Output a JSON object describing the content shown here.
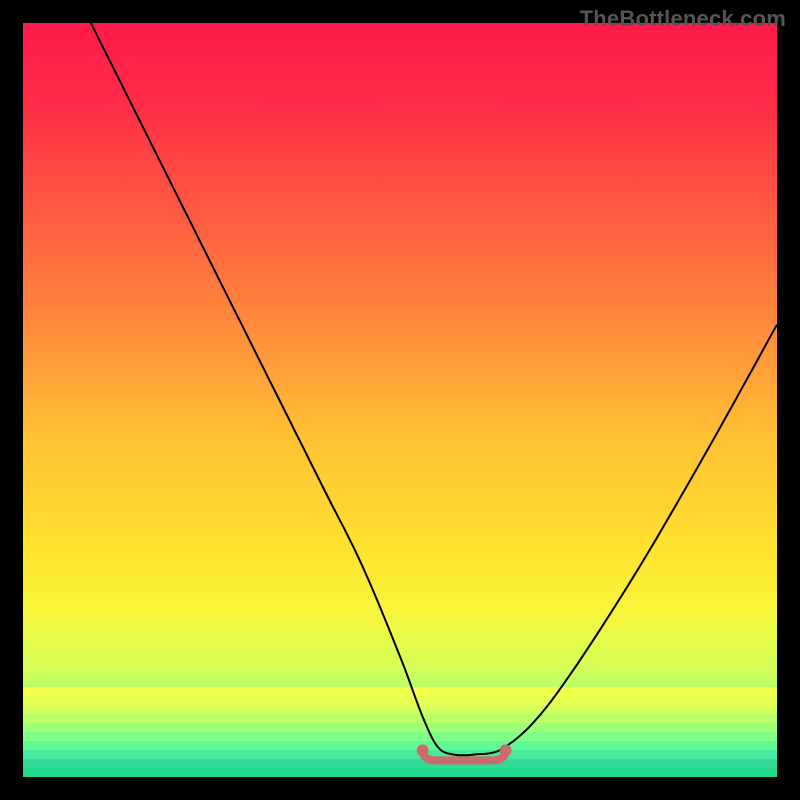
{
  "watermark": "TheBottleneck.com",
  "colors": {
    "background": "#000000",
    "curve": "#000000",
    "marker": "#cc6b6b",
    "gradient_stops": [
      {
        "offset": 0.0,
        "color": "#ff1a4b"
      },
      {
        "offset": 0.1,
        "color": "#ff2a47"
      },
      {
        "offset": 0.25,
        "color": "#ff5a42"
      },
      {
        "offset": 0.4,
        "color": "#ff8a3b"
      },
      {
        "offset": 0.55,
        "color": "#ffc133"
      },
      {
        "offset": 0.7,
        "color": "#ffe22f"
      },
      {
        "offset": 0.78,
        "color": "#f8f53a"
      },
      {
        "offset": 0.86,
        "color": "#d2ff5a"
      },
      {
        "offset": 0.92,
        "color": "#8fff80"
      },
      {
        "offset": 0.96,
        "color": "#4dffa0"
      },
      {
        "offset": 1.0,
        "color": "#1fd98a"
      }
    ],
    "bottom_stripes": [
      "#f4ff4a",
      "#e6ff50",
      "#d2ff5a",
      "#b8ff68",
      "#9cff76",
      "#80ff86",
      "#62f997",
      "#4ae9a0",
      "#33d994",
      "#1fd98a"
    ]
  },
  "chart_data": {
    "type": "line",
    "title": "",
    "xlabel": "",
    "ylabel": "",
    "xlim": [
      0,
      100
    ],
    "ylim": [
      0,
      100
    ],
    "grid": false,
    "legend": false,
    "series": [
      {
        "name": "bottleneck-curve",
        "x": [
          9,
          15,
          20,
          25,
          30,
          35,
          40,
          45,
          50,
          53,
          55,
          57,
          60,
          64,
          70,
          80,
          90,
          100
        ],
        "y": [
          100,
          88,
          78,
          68,
          58,
          48,
          38,
          28,
          16,
          8,
          4,
          3,
          3,
          4,
          10,
          25,
          42,
          60
        ]
      }
    ],
    "marker": {
      "name": "optimal-range",
      "x_start": 53,
      "x_end": 64,
      "y": 3
    }
  }
}
